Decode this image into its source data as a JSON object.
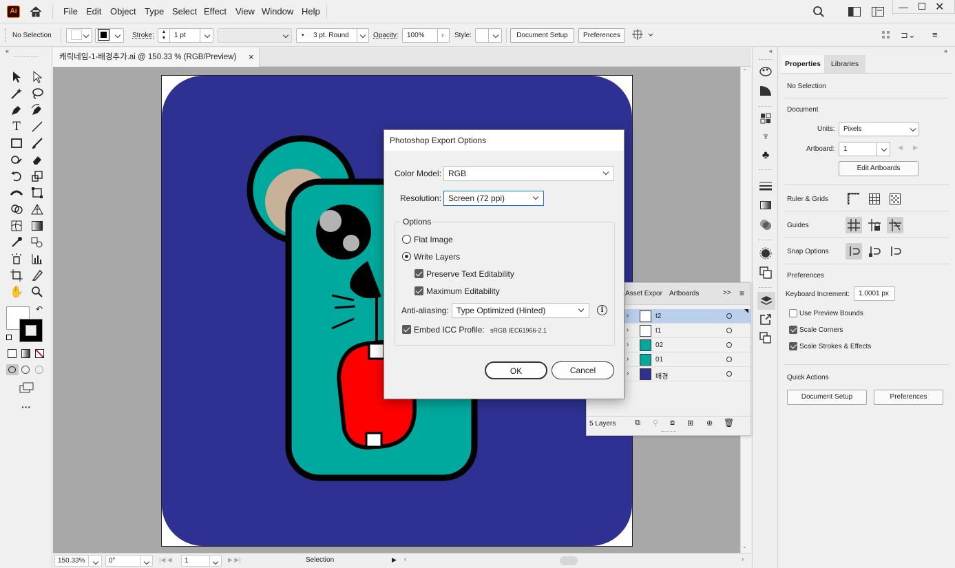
{
  "app": {
    "logo": "Ai"
  },
  "menu": [
    "File",
    "Edit",
    "Object",
    "Type",
    "Select",
    "Effect",
    "View",
    "Window",
    "Help"
  ],
  "control_bar": {
    "selection": "No Selection",
    "stroke_label": "Stroke:",
    "stroke_value": "1 pt",
    "brush": "3 pt. Round",
    "opacity_label": "Opacity:",
    "opacity_value": "100%",
    "style_label": "Style:",
    "document_setup": "Document Setup",
    "preferences": "Preferences"
  },
  "document": {
    "tab_title": "캐릭네임-1-배경추가.ai @ 150.33 % (RGB/Preview)",
    "close": "×"
  },
  "status_bar": {
    "zoom": "150.33%",
    "rotation": "0°",
    "artboard": "1",
    "tool": "Selection"
  },
  "properties": {
    "tabs": [
      "Properties",
      "Libraries"
    ],
    "selection": "No Selection",
    "document_heading": "Document",
    "units_label": "Units:",
    "units_value": "Pixels",
    "artboard_label": "Artboard:",
    "artboard_value": "1",
    "edit_artboards": "Edit Artboards",
    "ruler_grids": "Ruler & Grids",
    "guides": "Guides",
    "snap_options": "Snap Options",
    "preferences_heading": "Preferences",
    "keyboard_increment_label": "Keyboard Increment:",
    "keyboard_increment_value": "1.0001 px",
    "use_preview_bounds": "Use Preview Bounds",
    "scale_corners": "Scale Corners",
    "scale_strokes": "Scale Strokes & Effects",
    "checks": {
      "use_preview_bounds": false,
      "scale_corners": true,
      "scale_strokes": true
    },
    "quick_actions": "Quick Actions",
    "qa_document_setup": "Document Setup",
    "qa_preferences": "Preferences"
  },
  "layers_panel": {
    "tabs": [
      "Asset Expor",
      "Artboards"
    ],
    "menu": ">>",
    "rows": [
      {
        "name": "t2",
        "selected": true
      },
      {
        "name": "t1",
        "selected": false
      },
      {
        "name": "02",
        "selected": false
      },
      {
        "name": "01",
        "selected": false
      },
      {
        "name": "배경",
        "selected": false
      }
    ],
    "count": "5 Layers"
  },
  "dialog": {
    "title": "Photoshop Export Options",
    "color_model_label": "Color Model:",
    "color_model_value": "RGB",
    "resolution_label": "Resolution:",
    "resolution_value": "Screen (72 ppi)",
    "options_heading": "Options",
    "flat_image": "Flat Image",
    "write_layers": "Write Layers",
    "preserve_text": "Preserve Text Editability",
    "max_editability": "Maximum Editability",
    "anti_alias_label": "Anti-aliasing:",
    "anti_alias_value": "Type Optimized (Hinted)",
    "embed_icc": "Embed ICC Profile:",
    "icc_value": "sRGB IEC61966-2.1",
    "ok": "OK",
    "cancel": "Cancel",
    "selected_option": "Write Layers"
  },
  "colors": {
    "accent": "#1473e6",
    "artboard_bg": "#2e3192",
    "teal": "#00a99d",
    "mouth": "#ff0000",
    "ear": "#c7b299"
  }
}
